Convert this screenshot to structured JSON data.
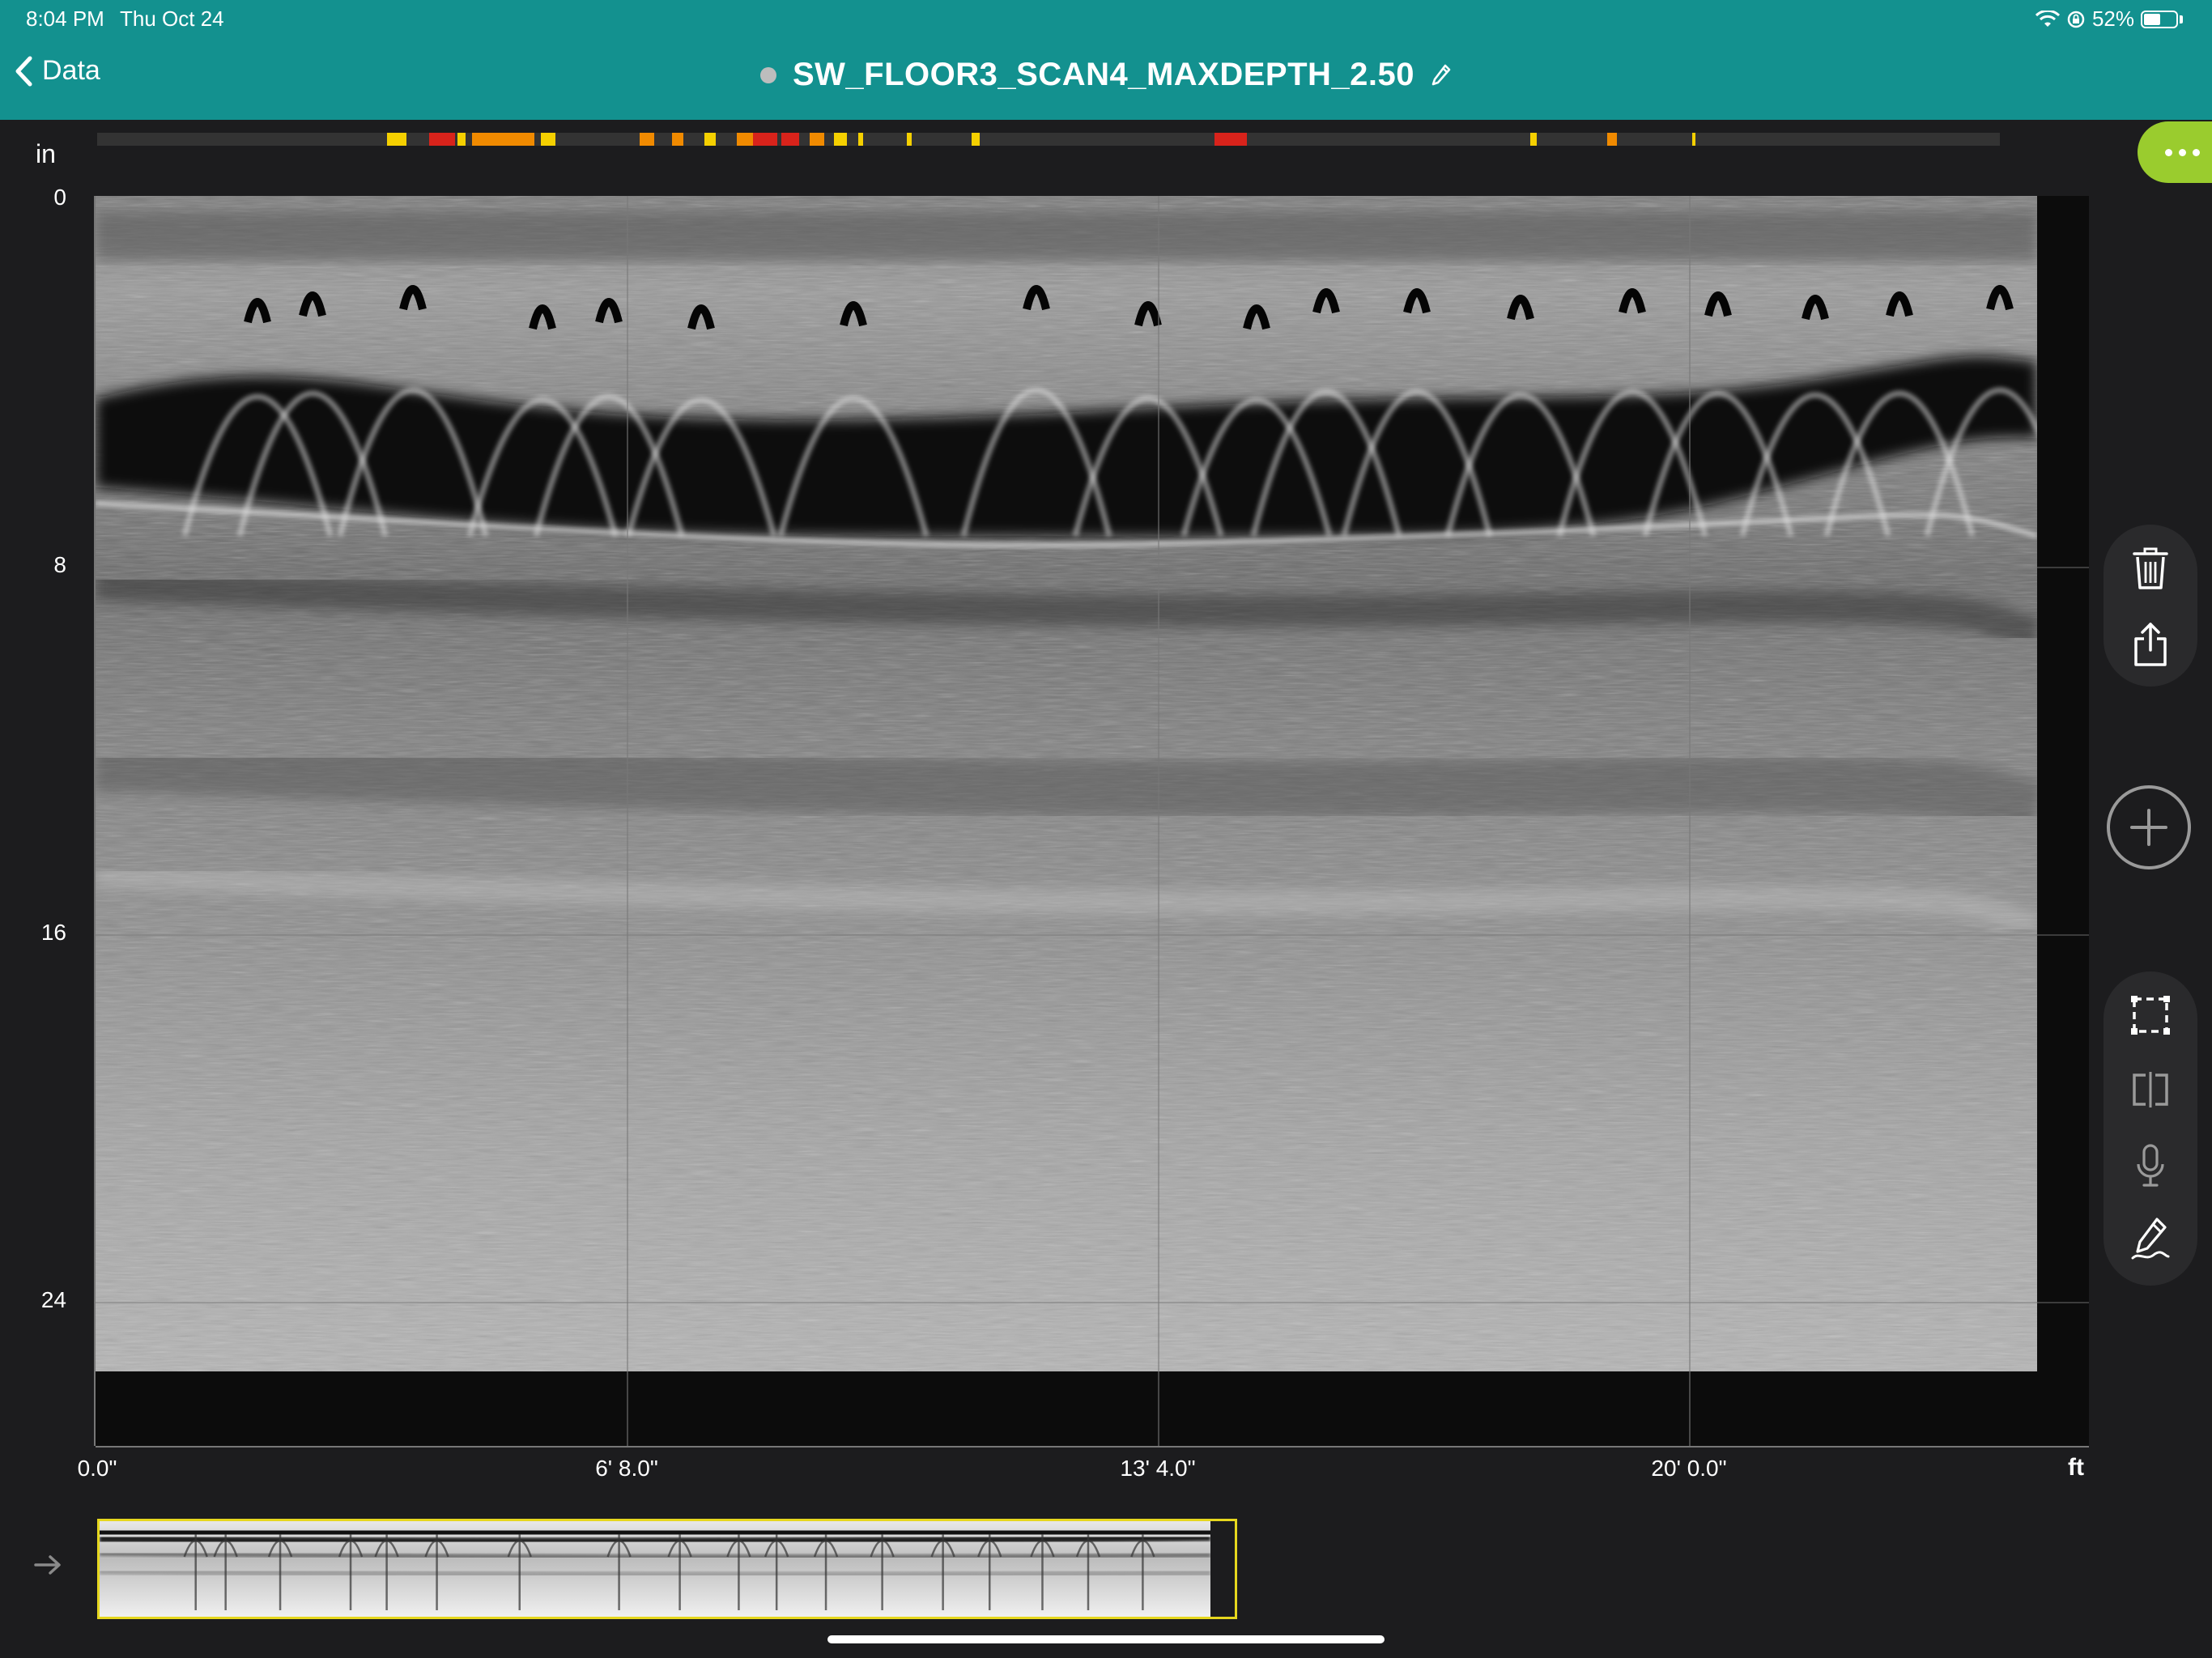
{
  "status_bar": {
    "time": "8:04 PM",
    "date": "Thu Oct 24",
    "battery": "52%",
    "icons": [
      "wifi-icon",
      "screen-lock-icon",
      "battery-icon"
    ]
  },
  "header": {
    "back_label": "Data",
    "scan_title": "SW_FLOOR3_SCAN4_MAXDEPTH_2.50",
    "status_dot_color": "#bdbdbd",
    "edit_icon": "pencil-icon",
    "background_color": "#13918f"
  },
  "depth_axis": {
    "unit": "in",
    "ticks": [
      "0",
      "8",
      "16",
      "24"
    ],
    "range": [
      0,
      25.5
    ]
  },
  "distance_axis": {
    "unit": "ft",
    "ticks": [
      "0.0\"",
      "6' 8.0\"",
      "13' 4.0\"",
      "20' 0.0\""
    ]
  },
  "heat_colors": {
    "yellow": "#f5d000",
    "orange": "#f08a00",
    "red": "#d8231b",
    "track": "#333333"
  },
  "toolbar": {
    "more_icon": "more-icon",
    "more_color": "#9acc2e",
    "actions": [
      "trash-icon",
      "share-icon"
    ],
    "add_icon": "plus-icon",
    "tools": [
      "select-region-icon",
      "split-view-icon",
      "microphone-icon",
      "annotate-pen-icon"
    ]
  },
  "overview": {
    "arrow_icon": "arrow-right-icon",
    "highlight_color": "#e6d71e"
  }
}
